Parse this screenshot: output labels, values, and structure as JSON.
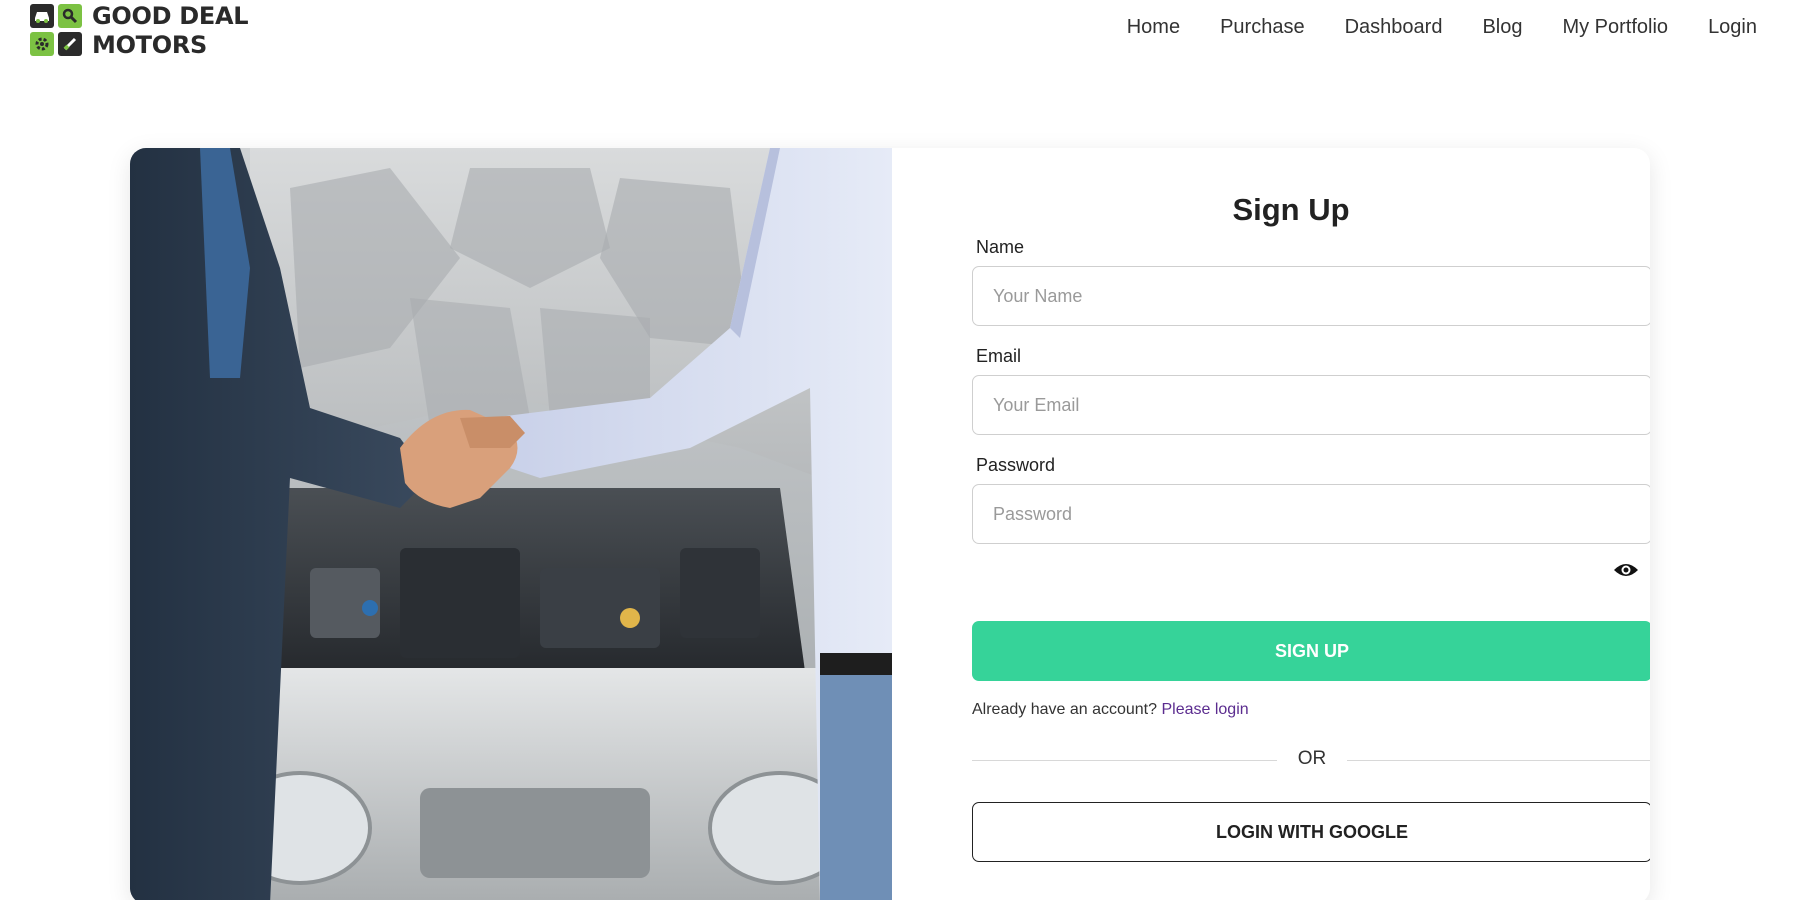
{
  "brand": {
    "line1": "GOOD DEAL",
    "line2": "MOTORS",
    "logo_icons": [
      "car-engine-icon",
      "wrench-icon",
      "gear-icon",
      "screwdriver-icon"
    ]
  },
  "nav": {
    "items": [
      {
        "label": "Home"
      },
      {
        "label": "Purchase"
      },
      {
        "label": "Dashboard"
      },
      {
        "label": "Blog"
      },
      {
        "label": "My Portfolio"
      },
      {
        "label": "Login"
      }
    ]
  },
  "hero_image": {
    "icon": "handshake-over-car-engine"
  },
  "form": {
    "title": "Sign Up",
    "name": {
      "label": "Name",
      "placeholder": "Your Name",
      "value": ""
    },
    "email": {
      "label": "Email",
      "placeholder": "Your Email",
      "value": ""
    },
    "password": {
      "label": "Password",
      "placeholder": "Password",
      "value": "",
      "toggle_icon": "eye-icon"
    },
    "submit_label": "SIGN UP",
    "already_text": "Already have an account?",
    "login_link": "Please login",
    "divider_text": "OR",
    "google_label": "LOGIN WITH GOOGLE"
  },
  "colors": {
    "accent": "#36d399",
    "link": "#5b2c8f",
    "logo_green": "#7cc243"
  }
}
